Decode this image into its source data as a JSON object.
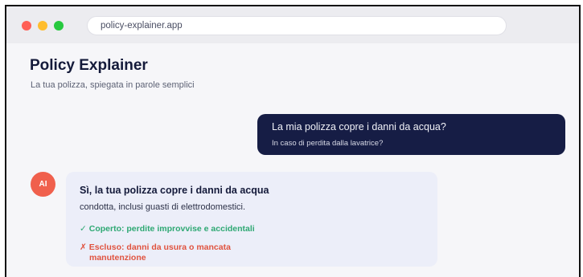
{
  "browser": {
    "url": "policy-explainer.app"
  },
  "header": {
    "title": "Policy Explainer",
    "subtitle": "La tua polizza, spiegata in parole semplici"
  },
  "user_message": {
    "question": "La mia polizza copre i danni da acqua?",
    "detail": "In caso di perdita dalla lavatrice?"
  },
  "ai_message": {
    "avatar_label": "AI",
    "heading": "Sì, la tua polizza copre i danni da acqua",
    "body": "condotta, inclusi guasti di elettrodomestici.",
    "covered_icon": "✓",
    "covered": "Coperto: perdite improvvise e accidentali",
    "excluded_icon": "✗",
    "excluded_line1": "Escluso: danni da usura o mancata",
    "excluded_line2": "manutenzione"
  },
  "colors": {
    "user_bubble": "#161d45",
    "ai_bubble": "#eceef9",
    "avatar": "#f0604d",
    "covered": "#2ea873",
    "excluded": "#e0533f"
  }
}
